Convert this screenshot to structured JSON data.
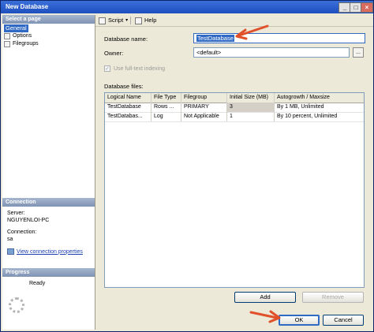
{
  "window": {
    "title": "New Database"
  },
  "left": {
    "select_page_header": "Select a page",
    "pages": [
      "General",
      "Options",
      "Filegroups"
    ],
    "connection_header": "Connection",
    "server_label": "Server:",
    "server_value": "NGUYENLOI-PC",
    "connection_label": "Connection:",
    "connection_value": "sa",
    "view_link": "View connection properties",
    "progress_header": "Progress",
    "progress_status": "Ready"
  },
  "toolbar": {
    "script": "Script",
    "help": "Help"
  },
  "form": {
    "db_name_label": "Database name:",
    "db_name_value": "TestDatabase",
    "owner_label": "Owner:",
    "owner_value": "<default>",
    "ellipsis": "...",
    "fulltext_label": "Use full-text indexing",
    "fulltext_checked": true,
    "files_label": "Database files:"
  },
  "files_table": {
    "headers": [
      "Logical Name",
      "File Type",
      "Filegroup",
      "Initial Size (MB)",
      "Autogrowth / Maxsize"
    ],
    "rows": [
      [
        "TestDatabase",
        "Rows ...",
        "PRIMARY",
        "3",
        "By 1 MB, Unlimited"
      ],
      [
        "TestDatabas...",
        "Log",
        "Not Applicable",
        "1",
        "By 10 percent, Unlimited"
      ]
    ]
  },
  "buttons": {
    "add": "Add",
    "remove": "Remove",
    "ok": "OK",
    "cancel": "Cancel"
  },
  "colors": {
    "titlebar": "#1d4fbf",
    "selection": "#316ac5",
    "arrow": "#e0502a"
  }
}
